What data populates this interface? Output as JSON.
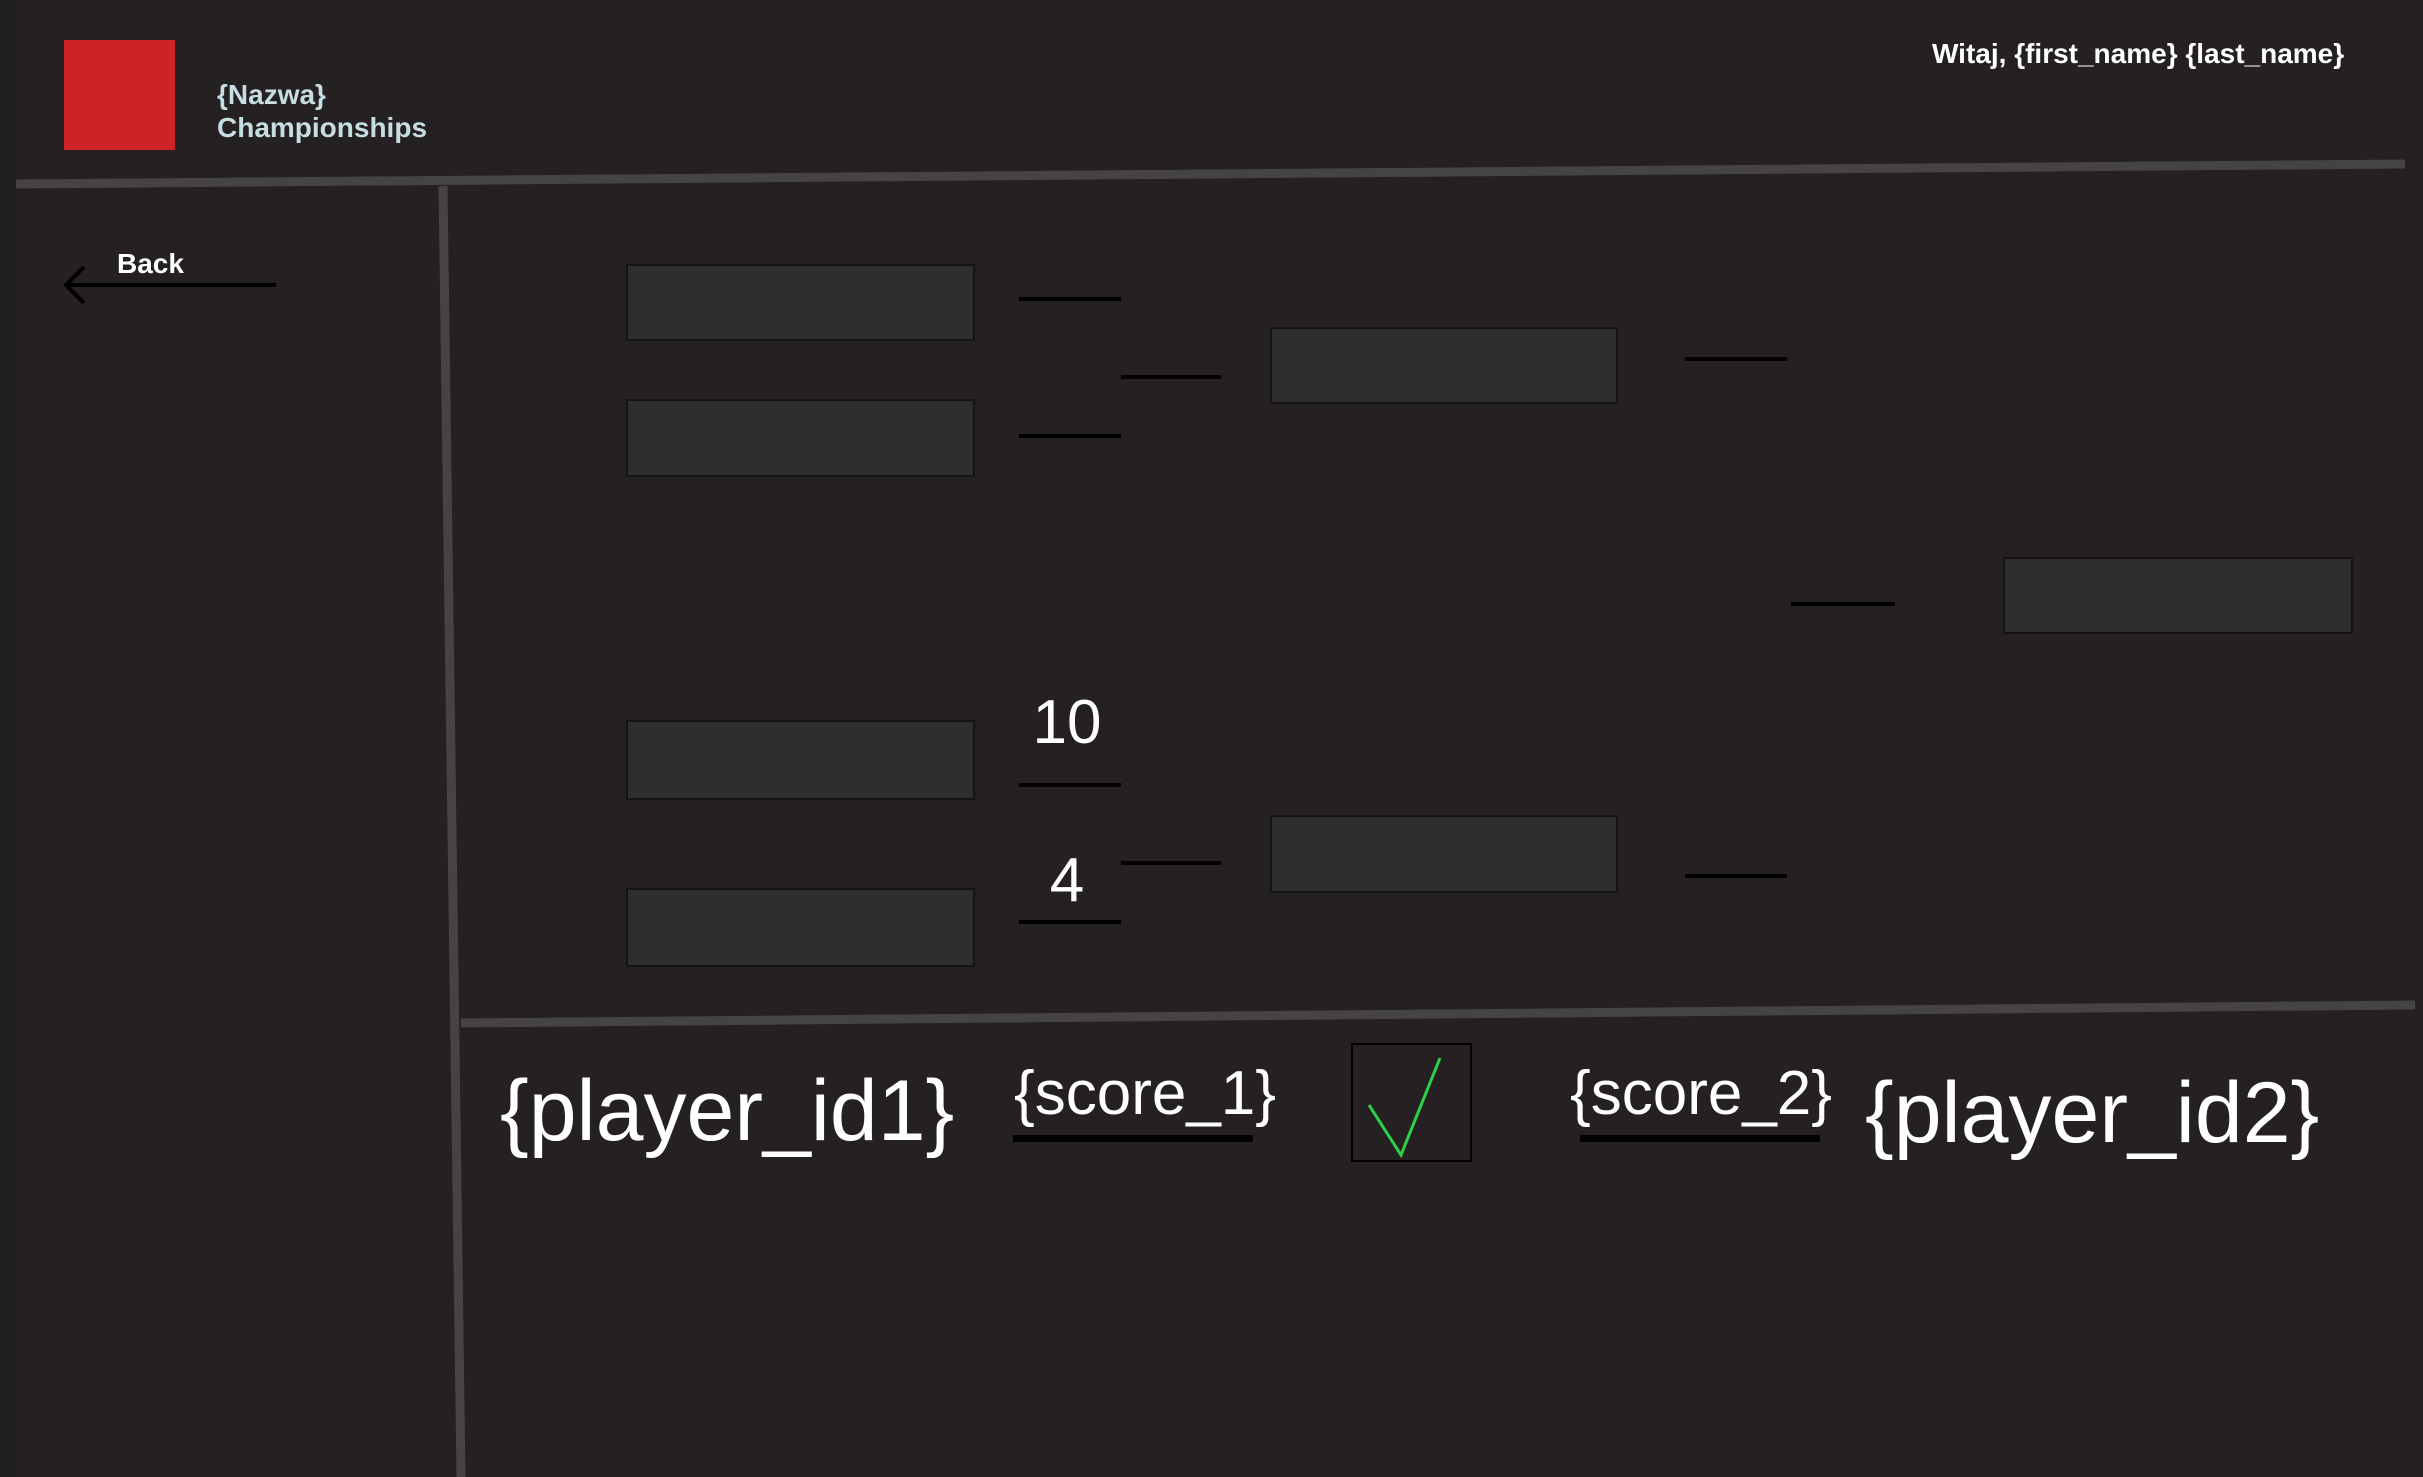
{
  "header": {
    "brand_line1": "{Nazwa}",
    "brand_line2": "Championships",
    "welcome": "Witaj, {first_name} {last_name}",
    "logo_color": "#cf2226"
  },
  "nav": {
    "back_label": "Back",
    "back_icon": "arrow-left-icon"
  },
  "bracket": {
    "round1_scores": [
      "10",
      "4"
    ]
  },
  "match": {
    "player1": "{player_id1}",
    "score1": "{score_1}",
    "player2": "{player_id2}",
    "score2": "{score_2}",
    "confirm_icon": "checkmark-icon",
    "confirm_color": "#2ed04a"
  }
}
